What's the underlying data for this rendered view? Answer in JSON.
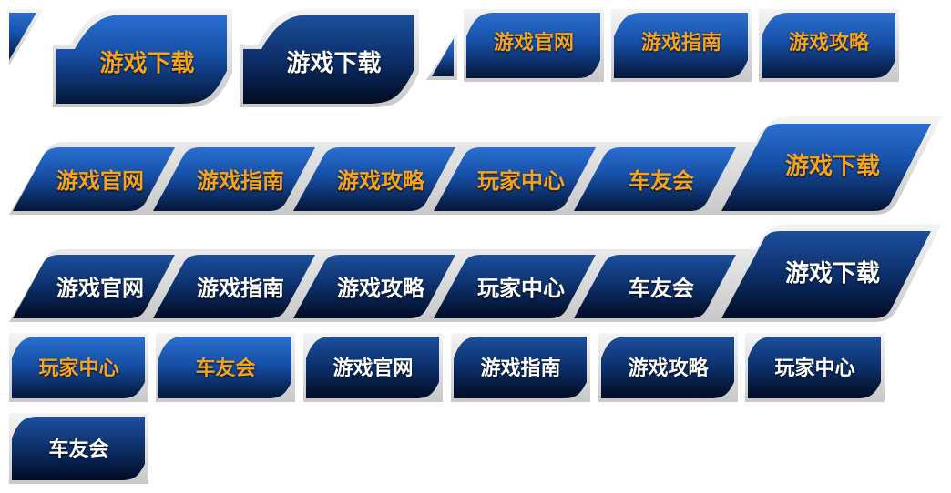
{
  "colors": {
    "active_text": "#f5a31e",
    "normal_text": "#ffffff",
    "tab_dark": "#061e4d",
    "tab_light": "#1d5bb5",
    "tab_border": "#d9d9d9"
  },
  "row1": {
    "tabs": [
      {
        "label": "游戏下载",
        "state": "active"
      },
      {
        "label": "游戏下载",
        "state": "normal"
      },
      {
        "label": "游戏官网",
        "state": "active"
      },
      {
        "label": "游戏指南",
        "state": "active"
      },
      {
        "label": "游戏攻略",
        "state": "active"
      }
    ]
  },
  "row2": {
    "tabs": [
      {
        "label": "游戏官网",
        "state": "active"
      },
      {
        "label": "游戏指南",
        "state": "active"
      },
      {
        "label": "游戏攻略",
        "state": "active"
      },
      {
        "label": "玩家中心",
        "state": "active"
      },
      {
        "label": "车友会",
        "state": "active"
      },
      {
        "label": "游戏下载",
        "state": "active"
      }
    ]
  },
  "row3": {
    "tabs": [
      {
        "label": "游戏官网",
        "state": "normal"
      },
      {
        "label": "游戏指南",
        "state": "normal"
      },
      {
        "label": "游戏攻略",
        "state": "normal"
      },
      {
        "label": "玩家中心",
        "state": "normal"
      },
      {
        "label": "车友会",
        "state": "normal"
      },
      {
        "label": "游戏下载",
        "state": "normal"
      }
    ]
  },
  "row4": {
    "tabs": [
      {
        "label": "玩家中心",
        "state": "active"
      },
      {
        "label": "车友会",
        "state": "active"
      },
      {
        "label": "游戏官网",
        "state": "normal"
      },
      {
        "label": "游戏指南",
        "state": "normal"
      },
      {
        "label": "游戏攻略",
        "state": "normal"
      },
      {
        "label": "玩家中心",
        "state": "normal"
      }
    ]
  },
  "row5": {
    "tabs": [
      {
        "label": "车友会",
        "state": "normal"
      }
    ]
  }
}
